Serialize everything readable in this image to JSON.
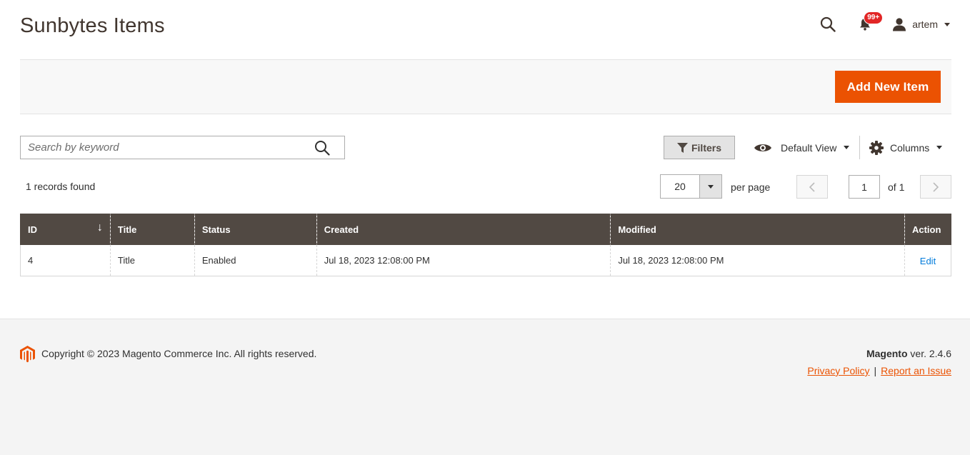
{
  "header": {
    "title": "Sunbytes Items",
    "notifications_badge": "99+",
    "user_name": "artem"
  },
  "action_bar": {
    "add_button_label": "Add New Item"
  },
  "toolbar": {
    "search_placeholder": "Search by keyword",
    "filters_label": "Filters",
    "view_label": "Default View",
    "columns_label": "Columns"
  },
  "pager": {
    "records_found": "1 records found",
    "per_page_value": "20",
    "per_page_label": "per page",
    "current_page": "1",
    "of_pages": "of 1"
  },
  "grid": {
    "columns": [
      "ID",
      "Title",
      "Status",
      "Created",
      "Modified",
      "Action"
    ],
    "sort_indicator": "↓",
    "rows": [
      {
        "id": "4",
        "title": "Title",
        "status": "Enabled",
        "created": "Jul 18, 2023 12:08:00 PM",
        "modified": "Jul 18, 2023 12:08:00 PM",
        "action": "Edit"
      }
    ]
  },
  "footer": {
    "copyright": "Copyright © 2023 Magento Commerce Inc. All rights reserved.",
    "brand": "Magento",
    "version": " ver. 2.4.6",
    "privacy_link": "Privacy Policy",
    "separator": "|",
    "report_link": "Report an Issue"
  },
  "colors": {
    "accent": "#eb5202",
    "grid_header": "#514943",
    "link": "#007bdb"
  },
  "icons": {
    "search": "search-icon",
    "notifications": "bell-icon",
    "user": "user-icon",
    "filter": "funnel-icon",
    "view": "eye-icon",
    "columns": "gear-icon",
    "logo": "magento-logo-icon"
  }
}
